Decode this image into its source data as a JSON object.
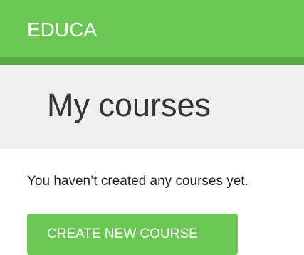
{
  "header": {
    "logo_text": "EDUCA"
  },
  "main": {
    "title": "My courses",
    "empty_message": "You haven’t created any courses yet.",
    "create_button_label": "CREATE NEW COURSE"
  },
  "colors": {
    "brand_green": "#6cc653",
    "header_shadow": "#58a93f",
    "title_band": "#efefef"
  }
}
